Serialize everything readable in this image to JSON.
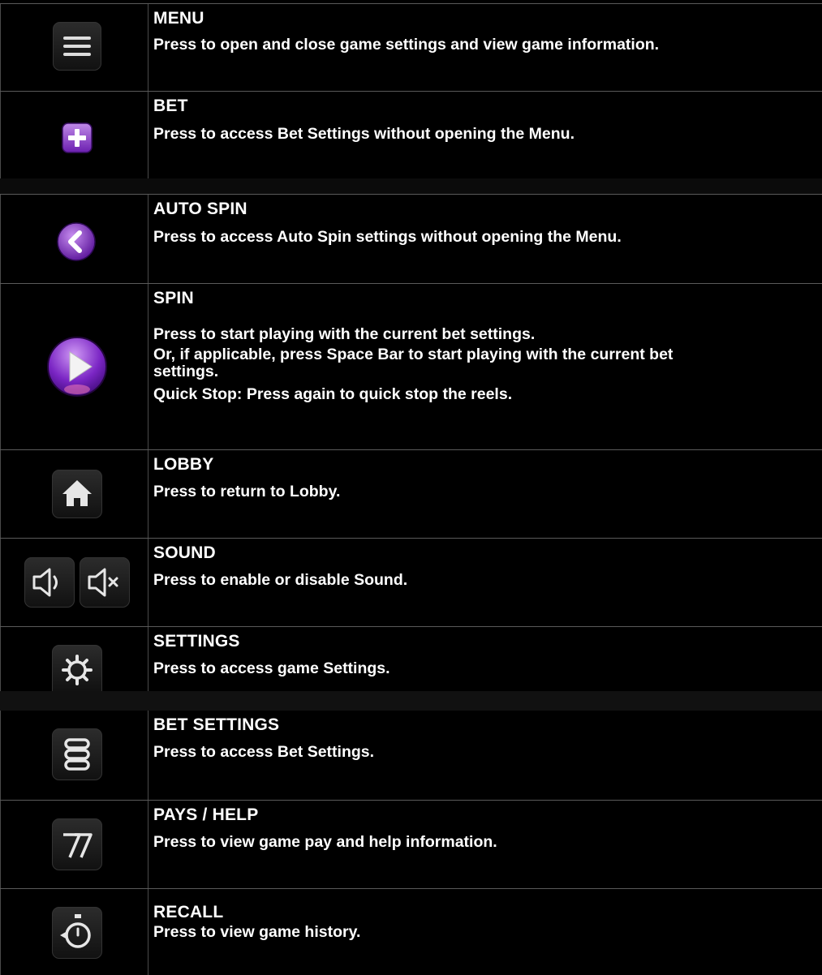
{
  "colors": {
    "background": "#000000",
    "accent_purple": "#8a2be2",
    "divider": "#5a5a5a"
  },
  "rows": [
    {
      "icon": "menu-icon",
      "title": "MENU",
      "desc": "Press to open and close game settings and view game information."
    },
    {
      "icon": "plus-icon",
      "title": "BET",
      "desc": "Press to access Bet Settings without opening the Menu."
    },
    {
      "icon": "chevron-left-icon",
      "title": "AUTO SPIN",
      "desc": "Press to access Auto Spin settings without opening the Menu."
    },
    {
      "icon": "play-icon",
      "title": "SPIN",
      "desc": [
        "Press to start playing with the current bet settings.",
        "Or, if applicable, press Space Bar to start playing with the current bet",
        "settings.",
        "Quick Stop: Press again to quick stop the reels."
      ]
    },
    {
      "icon": "home-icon",
      "title": "LOBBY",
      "desc": "Press to return to Lobby."
    },
    {
      "icon": "speaker-icon",
      "title": "SOUND",
      "desc": "Press to enable or disable Sound."
    },
    {
      "icon": "gear-icon",
      "title": "SETTINGS",
      "desc": "Press to access game Settings."
    },
    {
      "icon": "coin-stack-icon",
      "title": "BET SETTINGS",
      "desc": "Press to access Bet Settings."
    },
    {
      "icon": "seven-icon",
      "title": "PAYS / HELP",
      "desc": "Press to view game pay and help information."
    },
    {
      "icon": "stopwatch-icon",
      "title": "RECALL",
      "desc": "Press to view game history."
    }
  ]
}
